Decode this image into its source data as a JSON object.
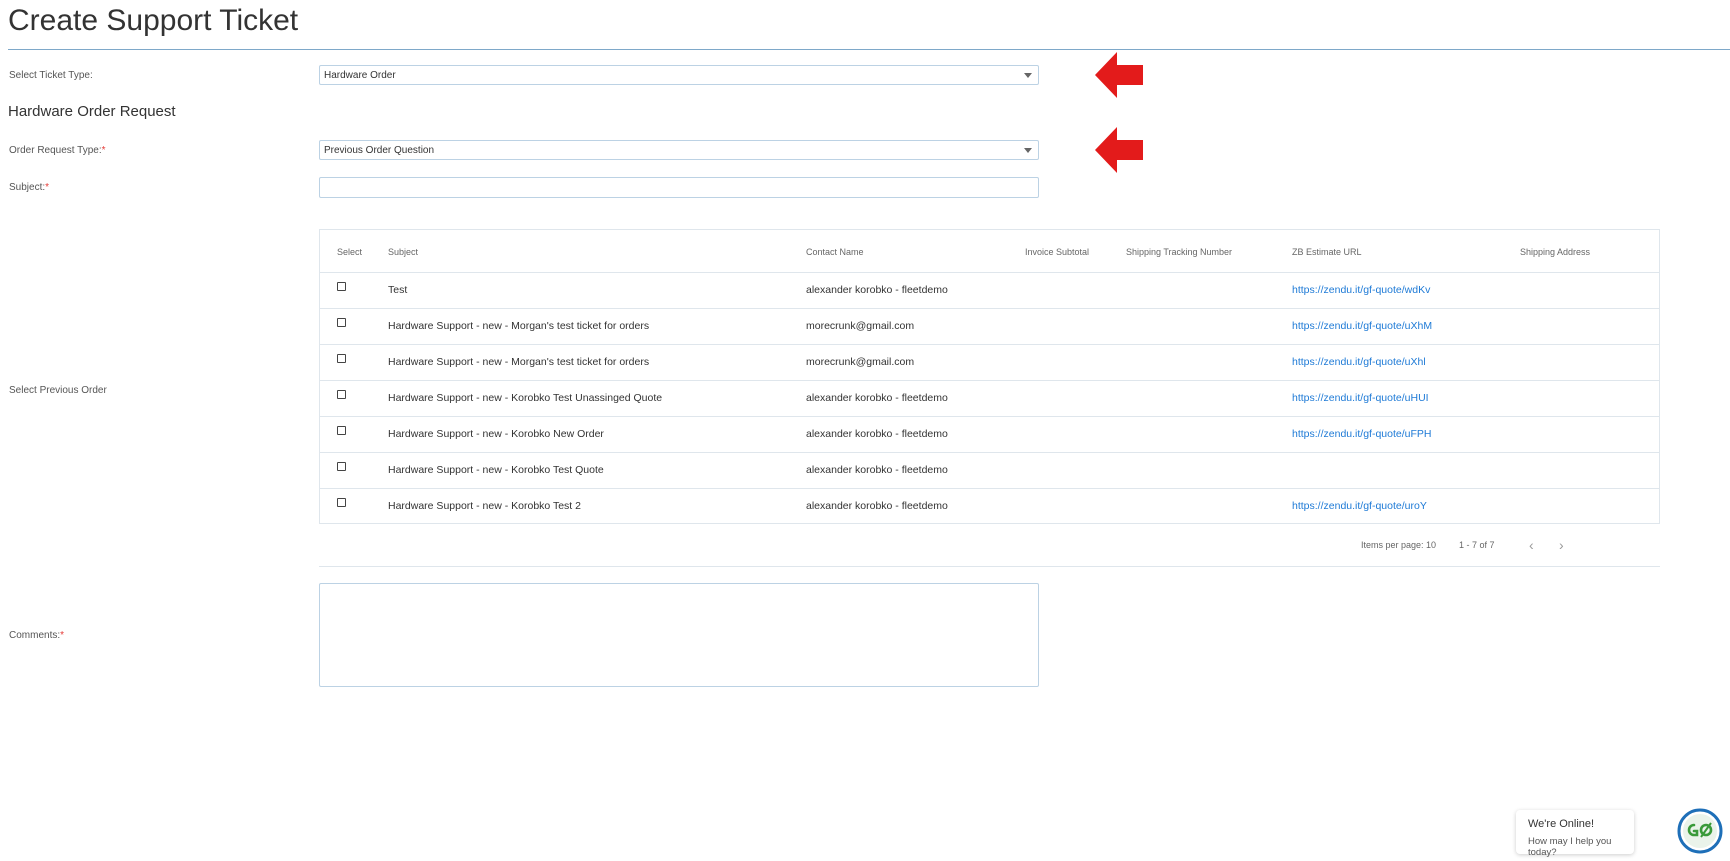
{
  "page": {
    "title": "Create Support Ticket"
  },
  "ticket_type": {
    "label": "Select Ticket Type:",
    "value": "Hardware Order"
  },
  "section": {
    "heading": "Hardware Order Request"
  },
  "order_request_type": {
    "label": "Order Request Type:",
    "required_mark": "*",
    "value": "Previous Order Question"
  },
  "subject": {
    "label": "Subject:",
    "required_mark": "*",
    "value": ""
  },
  "previous_order": {
    "label": "Select Previous Order",
    "columns": [
      "Select",
      "Subject",
      "Contact Name",
      "Invoice Subtotal",
      "Shipping Tracking Number",
      "ZB Estimate URL",
      "Shipping Address"
    ],
    "rows": [
      {
        "subject": "Test",
        "contact": "alexander korobko - fleetdemo",
        "invoice": "",
        "tracking": "",
        "url": "https://zendu.it/gf-quote/wdKv",
        "address": ""
      },
      {
        "subject": "Hardware Support - new - Morgan's test ticket for orders",
        "contact": "morecrunk@gmail.com",
        "invoice": "",
        "tracking": "",
        "url": "https://zendu.it/gf-quote/uXhM",
        "address": ""
      },
      {
        "subject": "Hardware Support - new - Morgan's test ticket for orders",
        "contact": "morecrunk@gmail.com",
        "invoice": "",
        "tracking": "",
        "url": "https://zendu.it/gf-quote/uXhl",
        "address": ""
      },
      {
        "subject": "Hardware Support - new - Korobko Test Unassinged Quote",
        "contact": "alexander korobko - fleetdemo",
        "invoice": "",
        "tracking": "",
        "url": "https://zendu.it/gf-quote/uHUI",
        "address": ""
      },
      {
        "subject": "Hardware Support - new - Korobko New Order",
        "contact": "alexander korobko - fleetdemo",
        "invoice": "",
        "tracking": "",
        "url": "https://zendu.it/gf-quote/uFPH",
        "address": ""
      },
      {
        "subject": "Hardware Support - new - Korobko Test Quote",
        "contact": "alexander korobko - fleetdemo",
        "invoice": "",
        "tracking": "",
        "url": "",
        "address": ""
      },
      {
        "subject": "Hardware Support - new - Korobko Test 2",
        "contact": "alexander korobko - fleetdemo",
        "invoice": "",
        "tracking": "",
        "url": "https://zendu.it/gf-quote/uroY",
        "address": ""
      }
    ],
    "paginator": {
      "items_per_page": "Items per page: 10",
      "range": "1 - 7 of 7",
      "prev_icon": "chevron-left-icon",
      "next_icon": "chevron-right-icon"
    }
  },
  "comments": {
    "label": "Comments:",
    "required_mark": "*",
    "value": ""
  },
  "annotations": {
    "arrow_icon": "red-arrow-left-icon",
    "arrow_color": "#e31b1b"
  },
  "chat": {
    "title": "We're Online!",
    "subtitle": "How may I help you today?",
    "avatar_icon": "go-logo-icon"
  },
  "colors": {
    "accent": "#1e7ad6",
    "border": "#bcd2e4",
    "rule": "#7ea8c9",
    "required": "#e53935"
  }
}
